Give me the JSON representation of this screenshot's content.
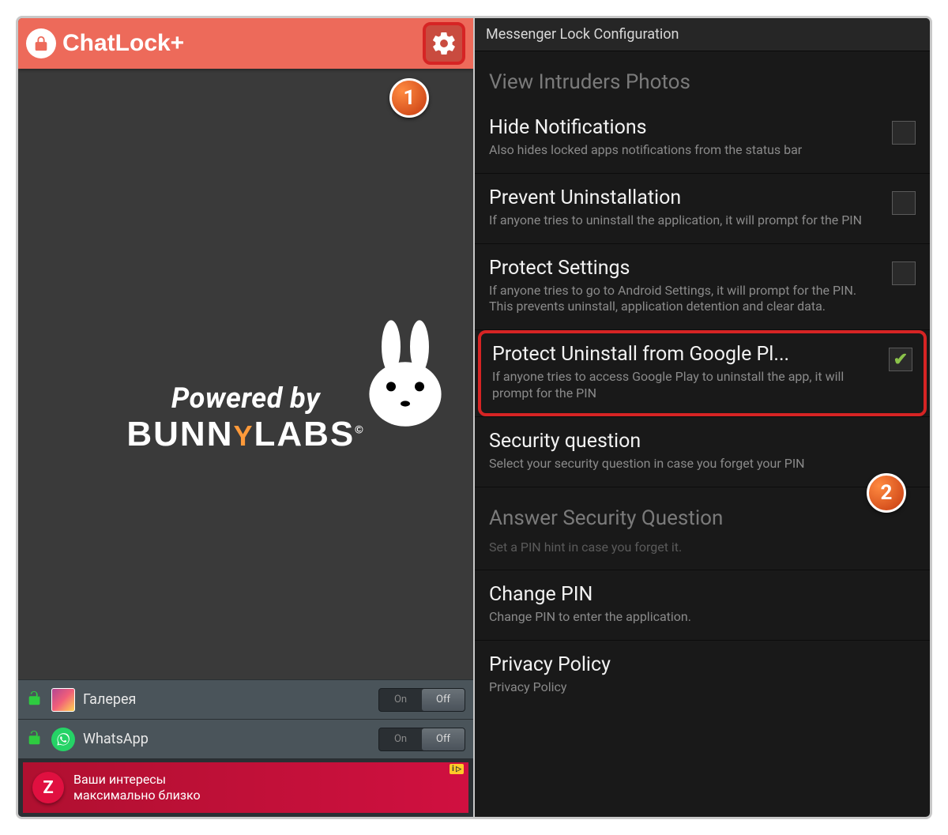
{
  "left": {
    "app_title": "ChatLock+",
    "splash_line1": "Powered by",
    "splash_brand_a": "BUNN",
    "splash_brand_b": "LABS",
    "apps": [
      {
        "name": "Галерея",
        "toggle_on": "On",
        "toggle_off": "Off",
        "state": "off",
        "icon": "gallery"
      },
      {
        "name": "WhatsApp",
        "toggle_on": "On",
        "toggle_off": "Off",
        "state": "off",
        "icon": "whatsapp"
      }
    ],
    "ad": {
      "line1": "Ваши интересы",
      "line2": "максимально близко",
      "tag": "i"
    }
  },
  "right": {
    "header": "Messenger Lock Configuration",
    "section_intruders": "View Intruders Photos",
    "items": [
      {
        "title": "Hide Notifications",
        "desc": "Also hides locked apps notifications from the status bar",
        "checkbox": true,
        "checked": false
      },
      {
        "title": "Prevent Uninstallation",
        "desc": "If anyone tries to uninstall the application, it will prompt for the PIN",
        "checkbox": true,
        "checked": false
      },
      {
        "title": "Protect Settings",
        "desc": "If anyone tries to go to Android Settings, it will prompt for the PIN. This prevents uninstall, application detention and clear data.",
        "checkbox": true,
        "checked": false
      },
      {
        "title": "Protect Uninstall from Google Pl...",
        "desc": "If anyone tries to access Google Play to uninstall the app, it will prompt for the PIN",
        "checkbox": true,
        "checked": true,
        "highlight": true
      },
      {
        "title": "Security question",
        "desc": "Select your security question in case you forget your PIN",
        "checkbox": false
      }
    ],
    "section_answer": "Answer Security Question",
    "answer_desc": "Set a PIN hint in case you forget it.",
    "items2": [
      {
        "title": "Change PIN",
        "desc": "Change PIN to enter the application."
      },
      {
        "title": "Privacy Policy",
        "desc": "Privacy Policy"
      }
    ]
  },
  "badges": {
    "one": "1",
    "two": "2"
  }
}
